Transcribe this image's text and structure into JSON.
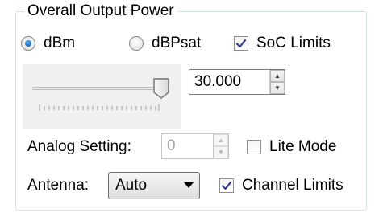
{
  "group": {
    "title": "Overall Output Power"
  },
  "units": {
    "dbm_label": "dBm",
    "dbpsat_label": "dBPsat",
    "selected": "dBm"
  },
  "soc_limits": {
    "label": "SoC Limits",
    "checked": true
  },
  "power": {
    "value": "30.000",
    "slider_level": 1.0
  },
  "analog": {
    "label": "Analog Setting:",
    "value": "0"
  },
  "lite_mode": {
    "label": "Lite Mode",
    "checked": false
  },
  "antenna": {
    "label": "Antenna:",
    "selected": "Auto"
  },
  "channel_limits": {
    "label": "Channel Limits",
    "checked": true
  },
  "colors": {
    "accent": "#1c6fc9",
    "check": "#3a3f8f",
    "group_border": "#d5dfe5"
  }
}
